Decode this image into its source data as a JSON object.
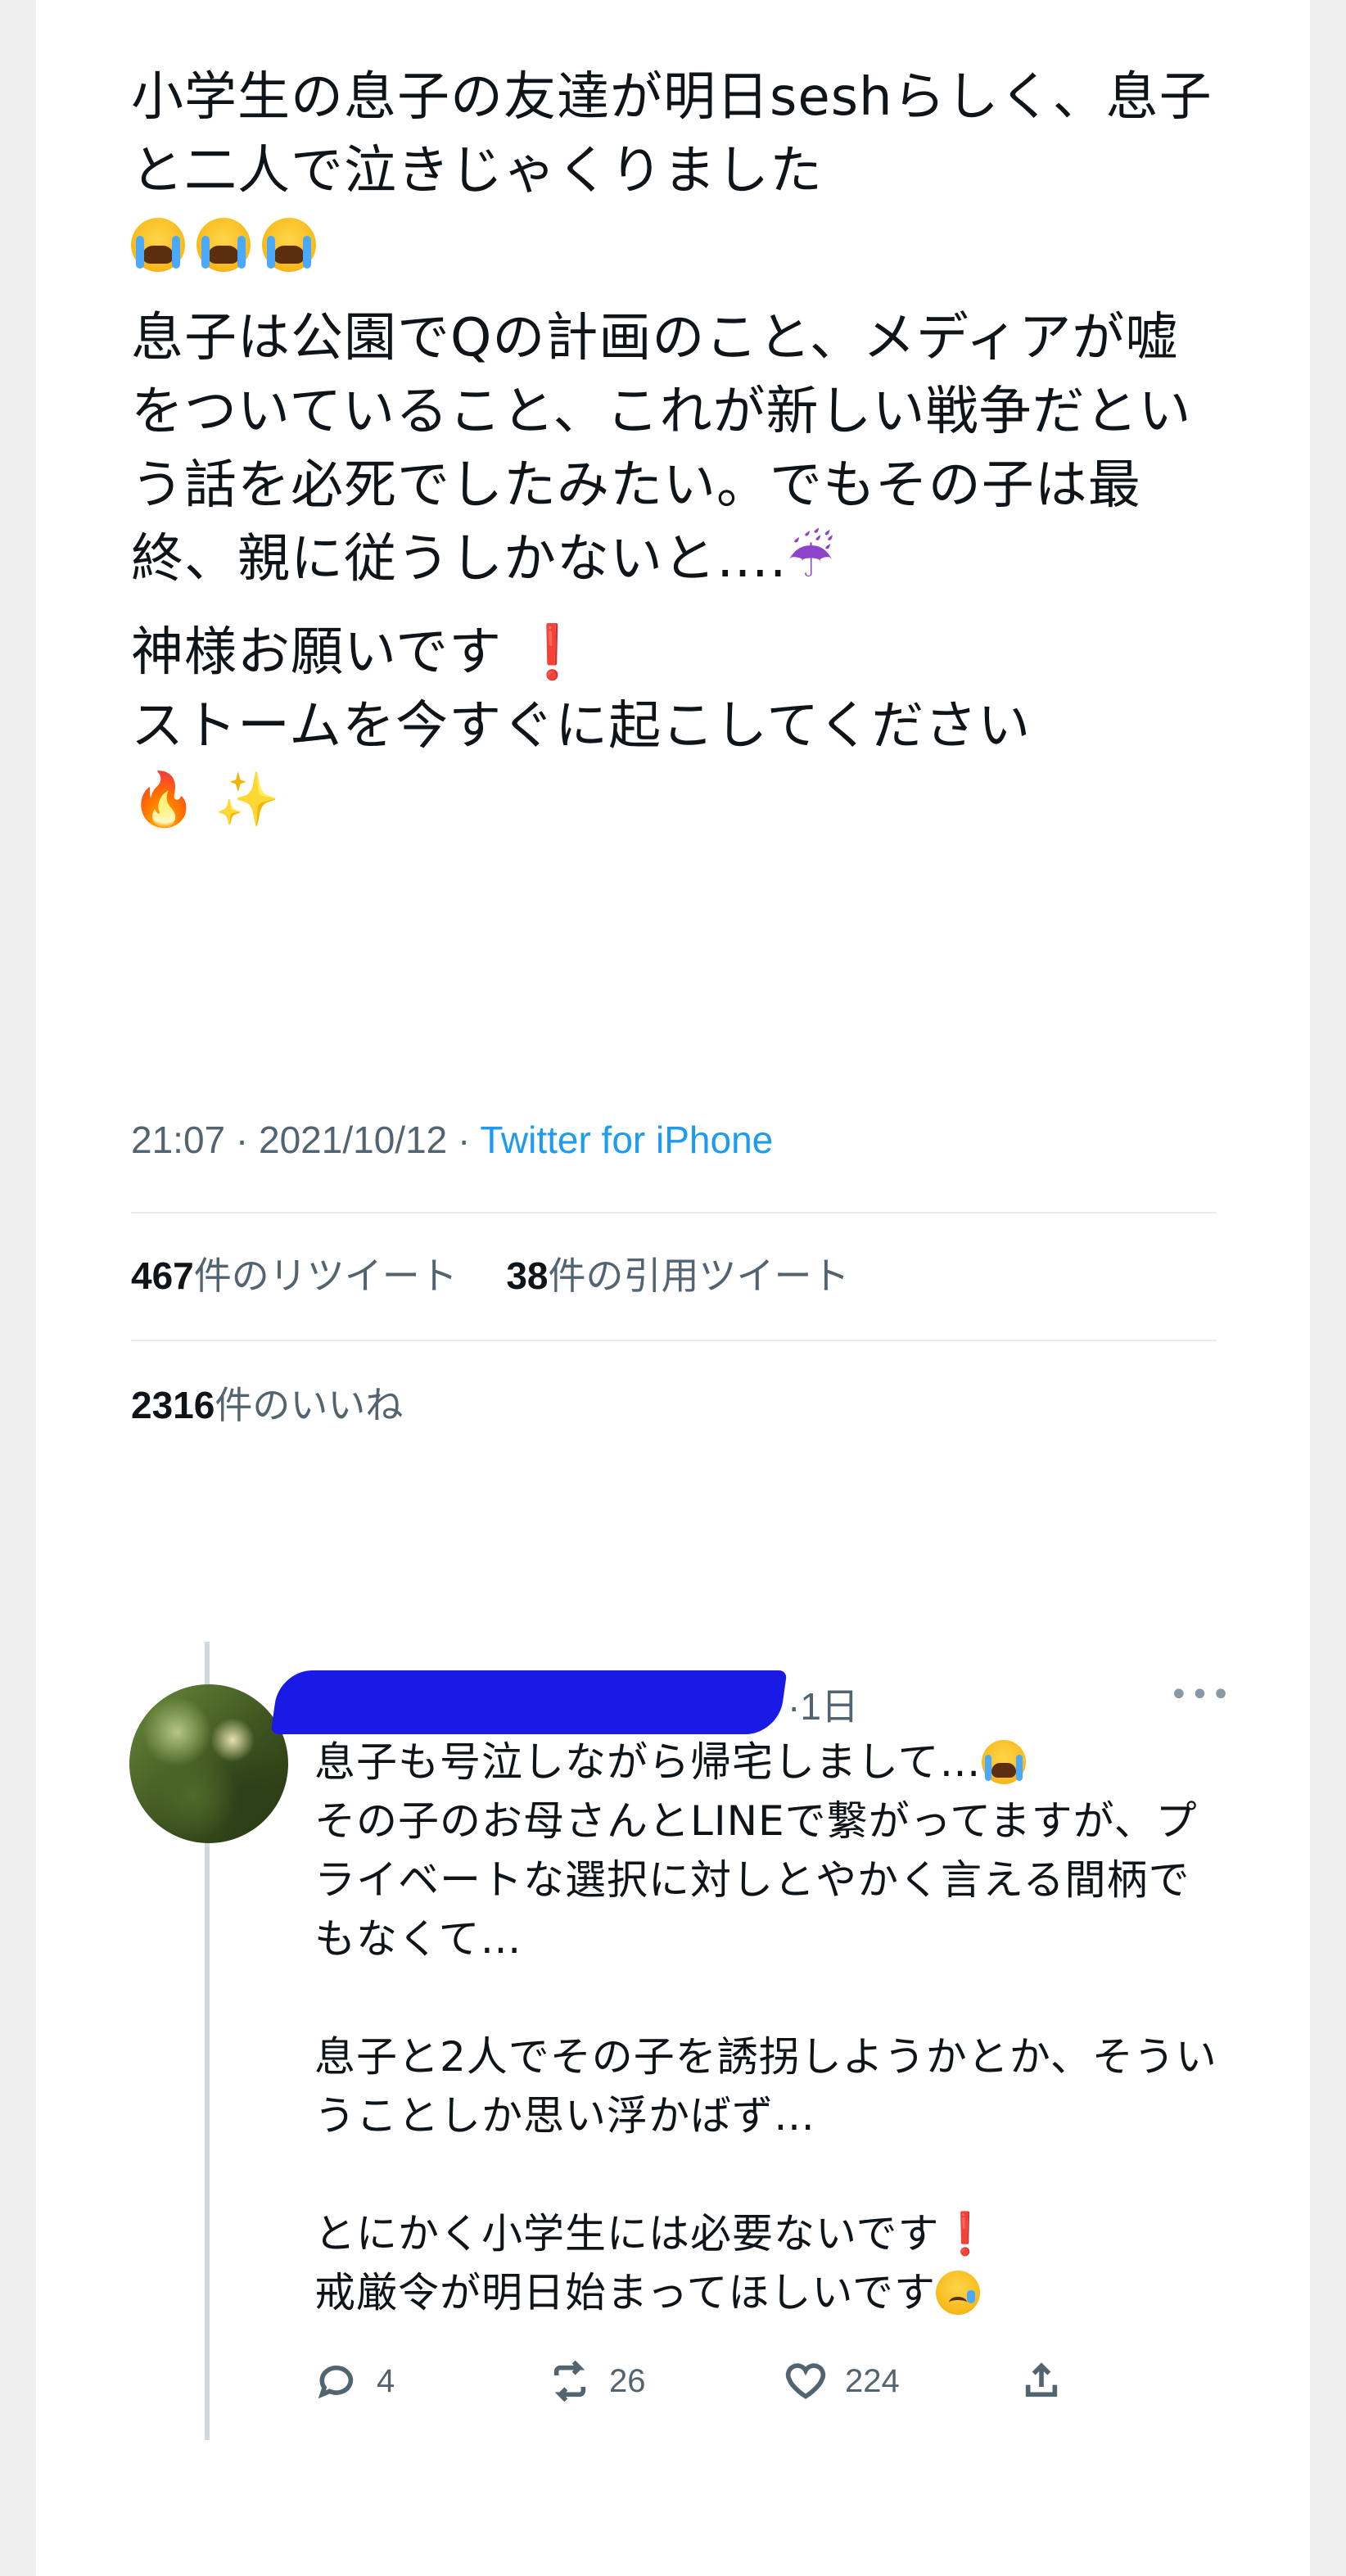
{
  "tweet": {
    "paragraphs": [
      "小学生の息子の友達が明日seshらしく、息子と二人で泣きじゃくりました",
      "息子は公園でQの計画のこと、メディアが嘘をついていること、これが新しい戦争だという話を必死でしたみたい。でもその子は最終、親に従うしかないと….",
      "神様お願いです",
      "ストームを今すぐに起こしてください"
    ],
    "emoji": {
      "umbrella": "☔",
      "fire": "🔥",
      "sparkles": "✨",
      "exclamation": "❗"
    },
    "time": "21:07",
    "date": "2021/10/12",
    "separator": "·",
    "source": "Twitter for iPhone",
    "retweets_count": "467",
    "retweets_label": "件のリツイート",
    "quotes_count": "38",
    "quotes_label": "件の引用ツイート",
    "likes_count": "2316",
    "likes_label": "件のいいね"
  },
  "reply": {
    "time": "·1日",
    "more": "•••",
    "lines_p1": "息子も号泣しながら帰宅しまして…",
    "lines_p1b": "その子のお母さんとLINEで繋がってますが、プライベートな選択に対しとやかく言える間柄でもなくて…",
    "lines_p2": "息子と2人でその子を誘拐しようかとか、そういうことしか思い浮かばず…",
    "lines_p3a": "とにかく小学生には必要ないです",
    "lines_p3b": "戒厳令が明日始まってほしいです",
    "reply_count": "4",
    "retweet_count": "26",
    "like_count": "224"
  }
}
